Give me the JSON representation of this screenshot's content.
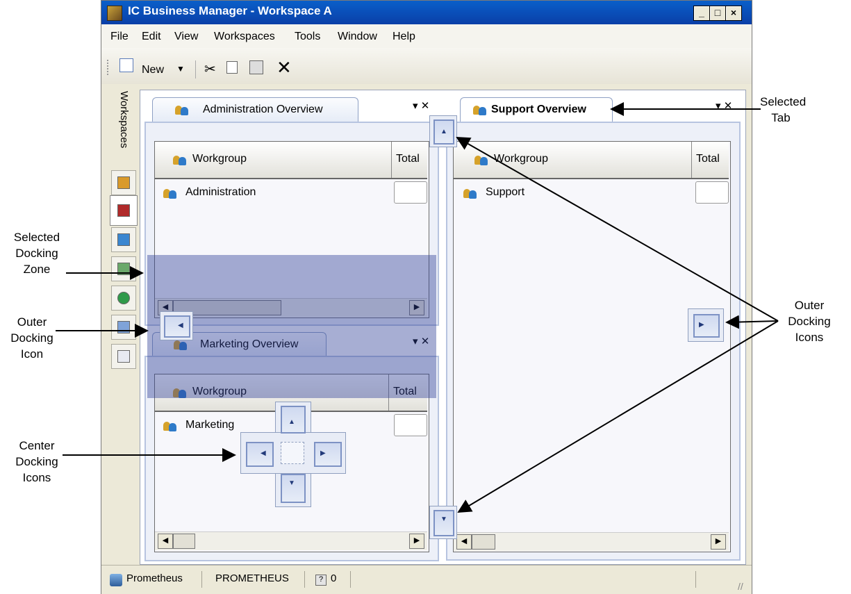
{
  "window": {
    "title": "IC Business Manager - Workspace A",
    "controls": [
      "_",
      "□",
      "×"
    ]
  },
  "menu": [
    "File",
    "Edit",
    "View",
    "Workspaces",
    "Tools",
    "Window",
    "Help"
  ],
  "toolbar": {
    "new_label": "New",
    "icons": [
      "new-icon",
      "cut-icon",
      "copy-icon",
      "paste-icon",
      "delete-icon"
    ]
  },
  "sidebar": {
    "label": "Workspaces",
    "buttons": [
      "home-icon",
      "user-icon",
      "help-icon",
      "chart-icon",
      "forward-icon",
      "card-icon",
      "list-icon"
    ]
  },
  "panels": {
    "admin": {
      "tab": "Administration Overview",
      "col1": "Workgroup",
      "col2": "Total",
      "row": "Administration"
    },
    "marketing": {
      "tab": "Marketing Overview",
      "col1": "Workgroup",
      "col2": "Total",
      "row": "Marketing"
    },
    "support": {
      "tab": "Support Overview",
      "col1": "Workgroup",
      "col2": "Total",
      "row": "Support"
    }
  },
  "statusbar": {
    "server": "Prometheus",
    "host": "PROMETHEUS",
    "count": "0"
  },
  "annotations": {
    "selected_tab": "Selected Tab",
    "selected_zone": "Selected Docking Zone",
    "outer_icon": "Outer Docking Icon",
    "center_icons": "Center Docking Icons",
    "outer_icons": "Outer Docking Icons"
  },
  "colors": {
    "title_bar": "#0a4fba",
    "docking_zone": "#2d3e96",
    "tab_border": "#8ea0c4"
  }
}
